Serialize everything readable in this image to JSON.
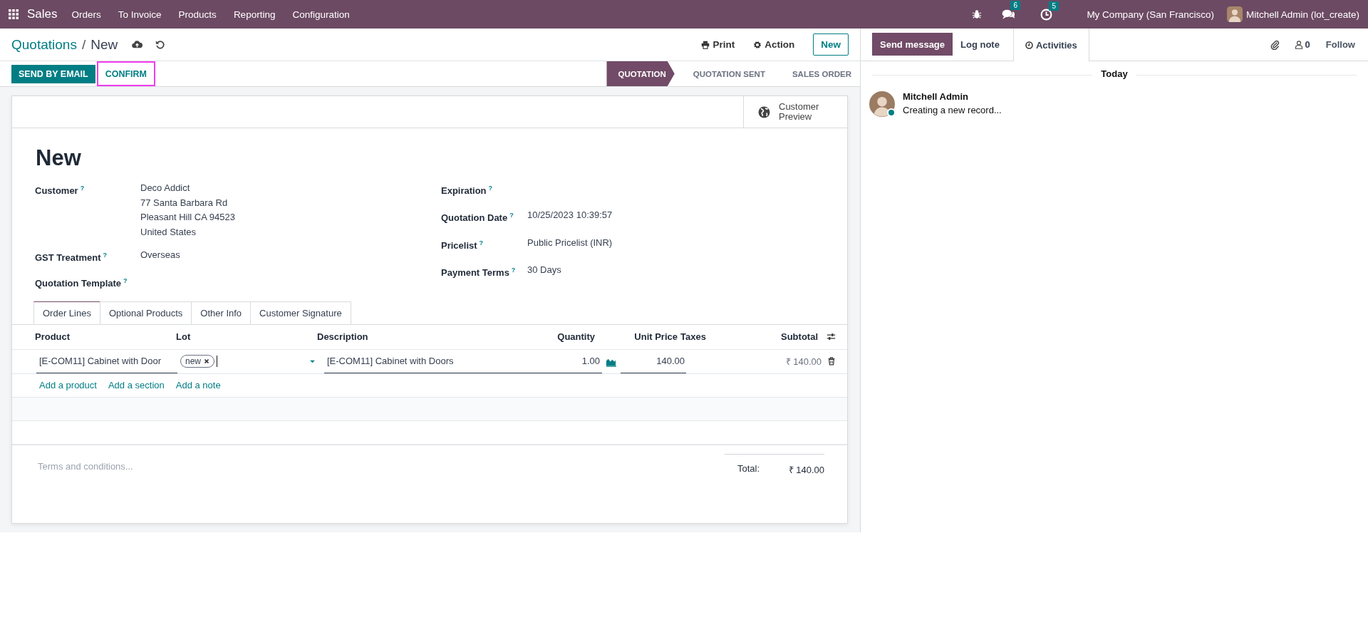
{
  "navbar": {
    "app": "Sales",
    "menu": [
      "Orders",
      "To Invoice",
      "Products",
      "Reporting",
      "Configuration"
    ],
    "messages_count": "6",
    "activities_count": "5",
    "company": "My Company (San Francisco)",
    "user": "Mitchell Admin (lot_create)"
  },
  "breadcrumb": {
    "parent": "Quotations",
    "separator": "/",
    "current": "New"
  },
  "header_actions": {
    "print": "Print",
    "action": "Action",
    "new": "New"
  },
  "buttons": [
    {
      "label": "SEND BY EMAIL",
      "kind": "primary",
      "highlighted": false
    },
    {
      "label": "CONFIRM",
      "kind": "secondary",
      "highlighted": true
    }
  ],
  "statusbar": [
    {
      "label": "QUOTATION",
      "selected": true
    },
    {
      "label": "QUOTATION SENT",
      "selected": false
    },
    {
      "label": "SALES ORDER",
      "selected": false
    }
  ],
  "sheet": {
    "customer_preview": "Customer Preview",
    "title": "New",
    "left_fields": [
      {
        "label": "Customer",
        "help": "?",
        "values": [
          "Deco Addict",
          "77 Santa Barbara Rd",
          "Pleasant Hill CA 94523",
          "United States"
        ]
      },
      {
        "label": "GST Treatment",
        "help": "?",
        "values": [
          "Overseas"
        ]
      },
      {
        "label": "Quotation Template",
        "help": "?"
      }
    ],
    "right_fields": [
      {
        "label": "Expiration",
        "help": "?"
      },
      {
        "label": "Quotation Date",
        "help": "?",
        "values": [
          "10/25/2023 10:39:57"
        ]
      },
      {
        "label": "Pricelist",
        "help": "?",
        "values": [
          "Public Pricelist (INR)"
        ]
      },
      {
        "label": "Payment Terms",
        "help": "?",
        "values": [
          "30 Days"
        ]
      }
    ],
    "tabs": [
      {
        "label": "Order Lines",
        "selected": true
      },
      {
        "label": "Optional Products",
        "selected": false
      },
      {
        "label": "Other Info",
        "selected": false
      },
      {
        "label": "Customer Signature",
        "selected": false
      }
    ],
    "columns": [
      "Product",
      "Lot",
      "Description",
      "Quantity",
      "Unit Price",
      "Taxes",
      "Subtotal"
    ],
    "rows": [
      {
        "product": "[E-COM11] Cabinet with Door",
        "lot_tag": "new",
        "description": "[E-COM11] Cabinet with Doors",
        "quantity": "1.00",
        "unit_price": "140.00",
        "subtotal": "₹ 140.00"
      }
    ],
    "add_links": [
      "Add a product",
      "Add a section",
      "Add a note"
    ],
    "terms_placeholder": "Terms and conditions...",
    "total_label": "Total:",
    "total_value": "₹ 140.00"
  },
  "chatter": {
    "tabs": [
      {
        "label": "Send message",
        "selected": true
      },
      {
        "label": "Log note",
        "selected": false
      }
    ],
    "activities": "Activities",
    "followers_count": "0",
    "follow": "Follow",
    "divider": "Today",
    "messages": [
      {
        "author": "Mitchell Admin",
        "body": "Creating a new record...",
        "online": true
      }
    ]
  }
}
